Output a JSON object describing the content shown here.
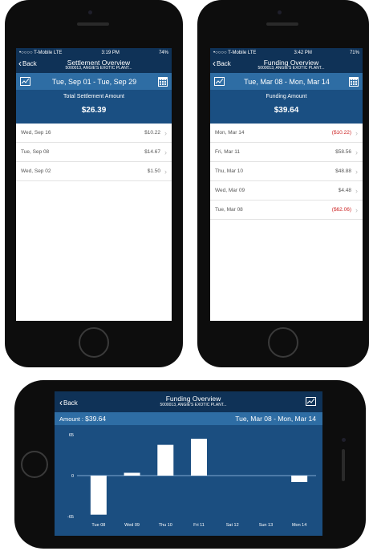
{
  "settlement": {
    "status": {
      "carrier": "•○○○○ T-Mobile  LTE",
      "time": "3:19 PM",
      "battery": "74%"
    },
    "back_label": "Back",
    "title": "Settlement Overview",
    "merchant": "5000013, ANGIE'S EXOTIC PLANT...",
    "date_range": "Tue, Sep 01 - Tue, Sep 29",
    "total_label": "Total Settlement Amount",
    "total_amount": "$26.39",
    "rows": [
      {
        "date": "Wed, Sep 16",
        "amount": "$10.22"
      },
      {
        "date": "Tue, Sep 08",
        "amount": "$14.67"
      },
      {
        "date": "Wed, Sep 02",
        "amount": "$1.50"
      }
    ]
  },
  "funding": {
    "status": {
      "carrier": "•○○○○ T-Mobile  LTE",
      "time": "3:42 PM",
      "battery": "71%"
    },
    "back_label": "Back",
    "title": "Funding Overview",
    "merchant": "5000013, ANGIE'S EXOTIC PLANT...",
    "date_range": "Tue, Mar 08 - Mon, Mar 14",
    "total_label": "Funding Amount",
    "total_amount": "$39.64",
    "rows": [
      {
        "date": "Mon, Mar 14",
        "amount": "($10.22)"
      },
      {
        "date": "Fri, Mar 11",
        "amount": "$58.56"
      },
      {
        "date": "Thu, Mar 10",
        "amount": "$48.88"
      },
      {
        "date": "Wed, Mar 09",
        "amount": "$4.48"
      },
      {
        "date": "Tue, Mar 08",
        "amount": "($62.06)"
      }
    ]
  },
  "landscape": {
    "back_label": "Back",
    "title": "Funding Overview",
    "merchant": "5000013, ANGIE'S EXOTIC PLANT...",
    "amount_label": "Amount :",
    "amount_value": "$39.64",
    "date_range": "Tue, Mar 08 - Mon, Mar 14"
  },
  "colors": {
    "navy": "#0f3257",
    "blue": "#2e6da4",
    "total_bg": "#1a4f82",
    "chart_bg": "#1b4e80",
    "negative": "#cc2222"
  },
  "icons": [
    "back-chevron-icon",
    "trend-chart-icon",
    "calendar-icon",
    "row-chevron-icon"
  ],
  "chart_data": {
    "type": "bar",
    "categories": [
      "Tue 08",
      "Wed 09",
      "Thu 10",
      "Fri 11",
      "Sat 12",
      "Sun 13",
      "Mon 14"
    ],
    "values": [
      -62.06,
      4.48,
      48.88,
      58.56,
      0,
      0,
      -10.22
    ],
    "y_tick_labels": [
      "65",
      "0",
      "-65"
    ],
    "ylim": [
      -65,
      65
    ],
    "grid": false
  }
}
